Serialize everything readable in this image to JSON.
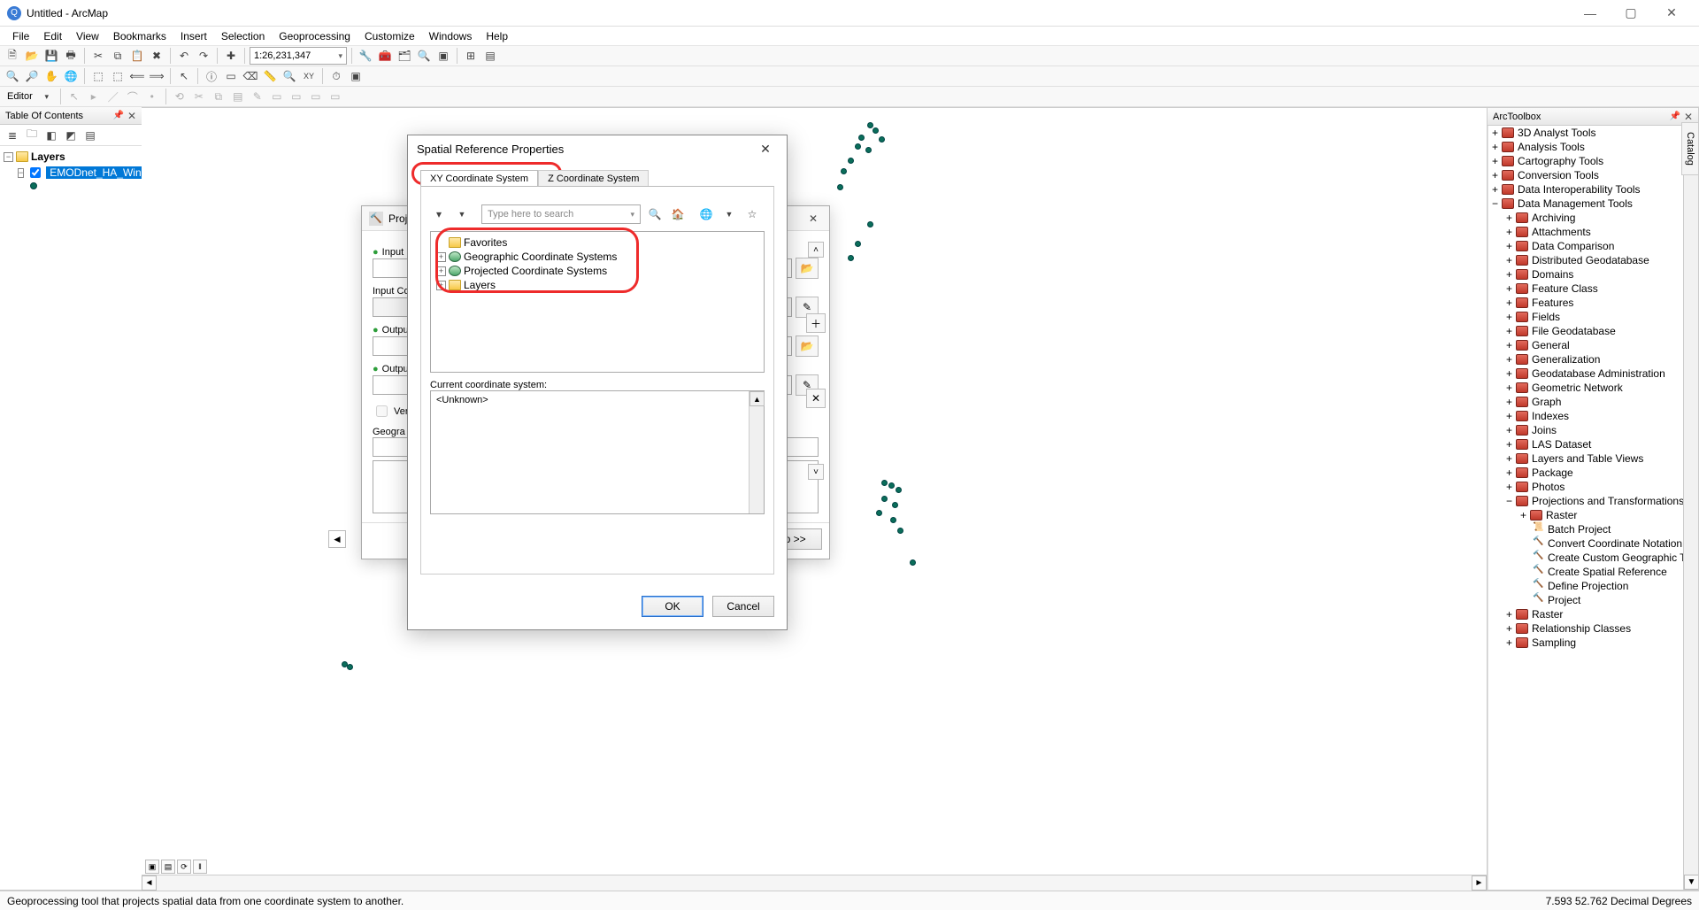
{
  "titlebar": {
    "title": "Untitled - ArcMap"
  },
  "menubar": [
    "File",
    "Edit",
    "View",
    "Bookmarks",
    "Insert",
    "Selection",
    "Geoprocessing",
    "Customize",
    "Windows",
    "Help"
  ],
  "toolbar1": {
    "scale": "1:26,231,347",
    "editor_label": "Editor"
  },
  "toc": {
    "title": "Table Of Contents",
    "root": "Layers",
    "layer": "EMODnet_HA_Wind"
  },
  "arctoolbox": {
    "title": "ArcToolbox",
    "top": [
      "3D Analyst Tools",
      "Analysis Tools",
      "Cartography Tools",
      "Conversion Tools",
      "Data Interoperability Tools"
    ],
    "dm": "Data Management Tools",
    "dm_children": [
      "Archiving",
      "Attachments",
      "Data Comparison",
      "Distributed Geodatabase",
      "Domains",
      "Feature Class",
      "Features",
      "Fields",
      "File Geodatabase",
      "General",
      "Generalization",
      "Geodatabase Administration",
      "Geometric Network",
      "Graph",
      "Indexes",
      "Joins",
      "LAS Dataset",
      "Layers and Table Views",
      "Package",
      "Photos"
    ],
    "proj": "Projections and Transformations",
    "proj_children": [
      "Raster"
    ],
    "proj_tools": [
      "Batch Project",
      "Convert Coordinate Notation",
      "Create Custom Geographic Tr",
      "Create Spatial Reference",
      "Define Projection",
      "Project"
    ],
    "dm_after": [
      "Raster",
      "Relationship Classes",
      "Sampling"
    ]
  },
  "catalog_tab": "Catalog",
  "statusbar": {
    "msg": "Geoprocessing tool that projects spatial data from one coordinate system to another.",
    "coords": "7.593  52.762 Decimal Degrees"
  },
  "proj_dialog": {
    "title": "Proje",
    "labels": {
      "input_ds": "Input Da",
      "input_cs": "Input Co",
      "output_ds": "Output D",
      "output_cs": "Output C",
      "vert": "Vert",
      "geo": "Geogra"
    },
    "help_btn": "elp >>"
  },
  "srs_dialog": {
    "title": "Spatial Reference Properties",
    "tab_xy": "XY Coordinate System",
    "tab_z": "Z Coordinate System",
    "search_placeholder": "Type here to search",
    "tree": [
      "Favorites",
      "Geographic Coordinate Systems",
      "Projected Coordinate Systems",
      "Layers"
    ],
    "current_label": "Current coordinate system:",
    "current_value": "<Unknown>",
    "ok": "OK",
    "cancel": "Cancel"
  }
}
